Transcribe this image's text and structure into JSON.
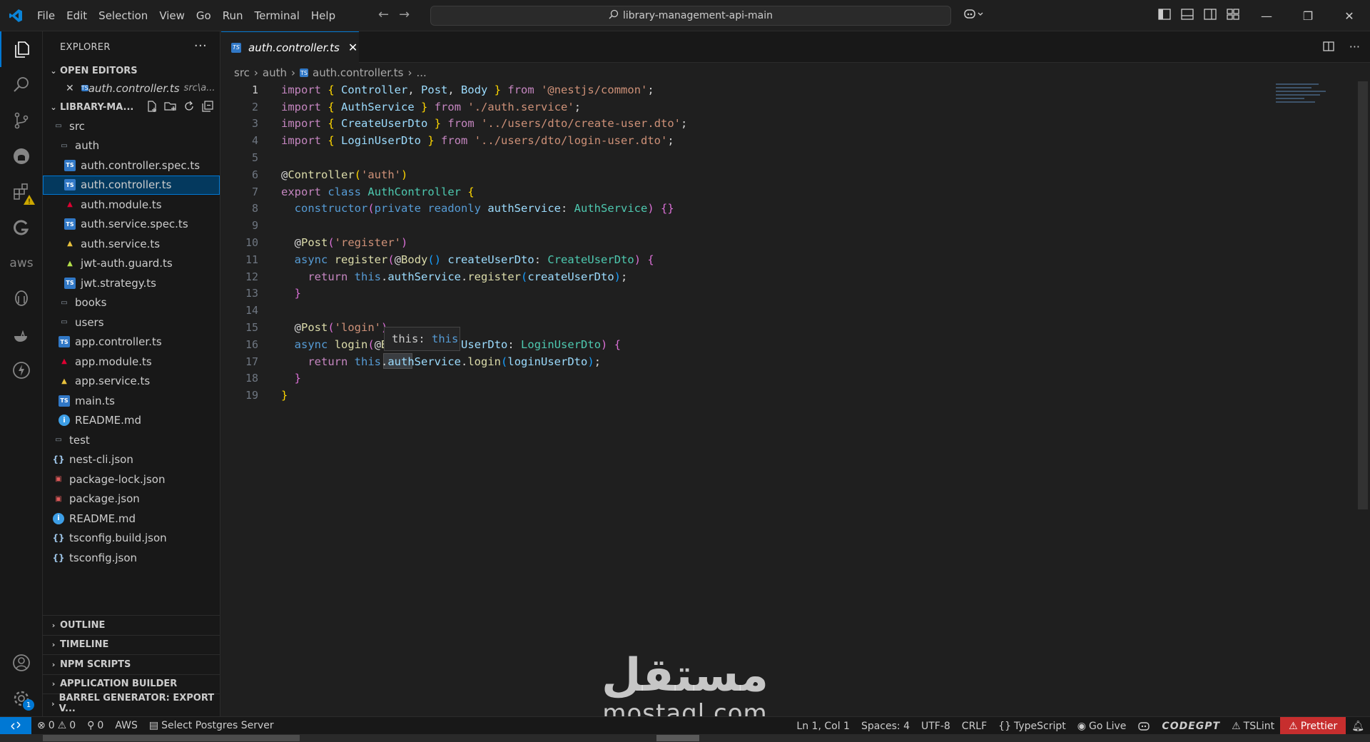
{
  "titlebar": {
    "menu": [
      "File",
      "Edit",
      "Selection",
      "View",
      "Go",
      "Run",
      "Terminal",
      "Help"
    ],
    "search_text": "library-management-api-main"
  },
  "activity_bar": {
    "items": [
      "explorer-icon",
      "search-icon",
      "source-control-icon",
      "github-icon",
      "extensions-icon",
      "gitlens-icon",
      "aws-icon",
      "database-icon",
      "docker-icon",
      "lightning-icon"
    ],
    "aws_label": "aws",
    "settings_badge": "1"
  },
  "sidebar": {
    "title": "EXPLORER",
    "open_editors_label": "OPEN EDITORS",
    "open_editor_file": "auth.controller.ts",
    "open_editor_path": "src\\a...",
    "root_label": "LIBRARY-MA...",
    "tree": [
      {
        "name": "src",
        "indent": 0,
        "icon": "folder",
        "selected": false
      },
      {
        "name": "auth",
        "indent": 1,
        "icon": "folder",
        "selected": false
      },
      {
        "name": "auth.controller.spec.ts",
        "indent": 2,
        "icon": "ts",
        "selected": false
      },
      {
        "name": "auth.controller.ts",
        "indent": 2,
        "icon": "ts",
        "selected": true
      },
      {
        "name": "auth.module.ts",
        "indent": 2,
        "icon": "ng",
        "selected": false
      },
      {
        "name": "auth.service.spec.ts",
        "indent": 2,
        "icon": "ts",
        "selected": false
      },
      {
        "name": "auth.service.ts",
        "indent": 2,
        "icon": "ngy",
        "selected": false
      },
      {
        "name": "jwt-auth.guard.ts",
        "indent": 2,
        "icon": "ngg",
        "selected": false
      },
      {
        "name": "jwt.strategy.ts",
        "indent": 2,
        "icon": "ts",
        "selected": false
      },
      {
        "name": "books",
        "indent": 1,
        "icon": "folder",
        "selected": false
      },
      {
        "name": "users",
        "indent": 1,
        "icon": "folder",
        "selected": false
      },
      {
        "name": "app.controller.ts",
        "indent": 1,
        "icon": "ts",
        "selected": false
      },
      {
        "name": "app.module.ts",
        "indent": 1,
        "icon": "ng",
        "selected": false
      },
      {
        "name": "app.service.ts",
        "indent": 1,
        "icon": "ngy",
        "selected": false
      },
      {
        "name": "main.ts",
        "indent": 1,
        "icon": "ts",
        "selected": false
      },
      {
        "name": "README.md",
        "indent": 1,
        "icon": "info",
        "selected": false
      },
      {
        "name": "test",
        "indent": 0,
        "icon": "folder",
        "selected": false
      },
      {
        "name": "nest-cli.json",
        "indent": 0,
        "icon": "json",
        "selected": false
      },
      {
        "name": "package-lock.json",
        "indent": 0,
        "icon": "pkg",
        "selected": false
      },
      {
        "name": "package.json",
        "indent": 0,
        "icon": "pkg",
        "selected": false
      },
      {
        "name": "README.md",
        "indent": 0,
        "icon": "info",
        "selected": false
      },
      {
        "name": "tsconfig.build.json",
        "indent": 0,
        "icon": "json",
        "selected": false
      },
      {
        "name": "tsconfig.json",
        "indent": 0,
        "icon": "json",
        "selected": false
      }
    ],
    "bottom_sections": [
      "OUTLINE",
      "TIMELINE",
      "NPM SCRIPTS",
      "APPLICATION BUILDER",
      "BARREL GENERATOR: EXPORT V..."
    ]
  },
  "editor": {
    "tab_label": "auth.controller.ts",
    "breadcrumb": [
      "src",
      "auth",
      "auth.controller.ts",
      "..."
    ],
    "hover": {
      "label": "this:",
      "value": "this"
    },
    "lines": [
      [
        [
          "kw2",
          "import"
        ],
        [
          "pun",
          " "
        ],
        [
          "br1",
          "{"
        ],
        [
          "pun",
          " "
        ],
        [
          "var",
          "Controller"
        ],
        [
          "pun",
          ", "
        ],
        [
          "var",
          "Post"
        ],
        [
          "pun",
          ", "
        ],
        [
          "var",
          "Body"
        ],
        [
          "pun",
          " "
        ],
        [
          "br1",
          "}"
        ],
        [
          "pun",
          " "
        ],
        [
          "kw2",
          "from"
        ],
        [
          "pun",
          " "
        ],
        [
          "str",
          "'@nestjs/common'"
        ],
        [
          "pun",
          ";"
        ]
      ],
      [
        [
          "kw2",
          "import"
        ],
        [
          "pun",
          " "
        ],
        [
          "br1",
          "{"
        ],
        [
          "pun",
          " "
        ],
        [
          "var",
          "AuthService"
        ],
        [
          "pun",
          " "
        ],
        [
          "br1",
          "}"
        ],
        [
          "pun",
          " "
        ],
        [
          "kw2",
          "from"
        ],
        [
          "pun",
          " "
        ],
        [
          "str",
          "'./auth.service'"
        ],
        [
          "pun",
          ";"
        ]
      ],
      [
        [
          "kw2",
          "import"
        ],
        [
          "pun",
          " "
        ],
        [
          "br1",
          "{"
        ],
        [
          "pun",
          " "
        ],
        [
          "var",
          "CreateUserDto"
        ],
        [
          "pun",
          " "
        ],
        [
          "br1",
          "}"
        ],
        [
          "pun",
          " "
        ],
        [
          "kw2",
          "from"
        ],
        [
          "pun",
          " "
        ],
        [
          "str",
          "'../users/dto/create-user.dto'"
        ],
        [
          "pun",
          ";"
        ]
      ],
      [
        [
          "kw2",
          "import"
        ],
        [
          "pun",
          " "
        ],
        [
          "br1",
          "{"
        ],
        [
          "pun",
          " "
        ],
        [
          "var",
          "LoginUserDto"
        ],
        [
          "pun",
          " "
        ],
        [
          "br1",
          "}"
        ],
        [
          "pun",
          " "
        ],
        [
          "kw2",
          "from"
        ],
        [
          "pun",
          " "
        ],
        [
          "str",
          "'../users/dto/login-user.dto'"
        ],
        [
          "pun",
          ";"
        ]
      ],
      [],
      [
        [
          "pun",
          "@"
        ],
        [
          "fn",
          "Controller"
        ],
        [
          "br1",
          "("
        ],
        [
          "str",
          "'auth'"
        ],
        [
          "br1",
          ")"
        ]
      ],
      [
        [
          "kw2",
          "export"
        ],
        [
          "pun",
          " "
        ],
        [
          "kw",
          "class"
        ],
        [
          "pun",
          " "
        ],
        [
          "cls",
          "AuthController"
        ],
        [
          "pun",
          " "
        ],
        [
          "br1",
          "{"
        ]
      ],
      [
        [
          "pun",
          "  "
        ],
        [
          "kw",
          "constructor"
        ],
        [
          "br2",
          "("
        ],
        [
          "kw",
          "private"
        ],
        [
          "pun",
          " "
        ],
        [
          "kw",
          "readonly"
        ],
        [
          "pun",
          " "
        ],
        [
          "var",
          "authService"
        ],
        [
          "pun",
          ": "
        ],
        [
          "cls",
          "AuthService"
        ],
        [
          "br2",
          ")"
        ],
        [
          "pun",
          " "
        ],
        [
          "br2",
          "{}"
        ]
      ],
      [],
      [
        [
          "pun",
          "  @"
        ],
        [
          "fn",
          "Post"
        ],
        [
          "br2",
          "("
        ],
        [
          "str",
          "'register'"
        ],
        [
          "br2",
          ")"
        ]
      ],
      [
        [
          "pun",
          "  "
        ],
        [
          "kw",
          "async"
        ],
        [
          "pun",
          " "
        ],
        [
          "fn",
          "register"
        ],
        [
          "br2",
          "("
        ],
        [
          "pun",
          "@"
        ],
        [
          "fn",
          "Body"
        ],
        [
          "br3",
          "()"
        ],
        [
          "pun",
          " "
        ],
        [
          "var",
          "createUserDto"
        ],
        [
          "pun",
          ": "
        ],
        [
          "cls",
          "CreateUserDto"
        ],
        [
          "br2",
          ")"
        ],
        [
          "pun",
          " "
        ],
        [
          "br2",
          "{"
        ]
      ],
      [
        [
          "pun",
          "    "
        ],
        [
          "kw2",
          "return"
        ],
        [
          "pun",
          " "
        ],
        [
          "kw",
          "this"
        ],
        [
          "pun",
          "."
        ],
        [
          "var",
          "authService"
        ],
        [
          "pun",
          "."
        ],
        [
          "fn",
          "register"
        ],
        [
          "br3",
          "("
        ],
        [
          "var",
          "createUserDto"
        ],
        [
          "br3",
          ")"
        ],
        [
          "pun",
          ";"
        ]
      ],
      [
        [
          "pun",
          "  "
        ],
        [
          "br2",
          "}"
        ]
      ],
      [],
      [
        [
          "pun",
          "  @"
        ],
        [
          "fn",
          "Post"
        ],
        [
          "br2",
          "("
        ],
        [
          "str",
          "'login'"
        ],
        [
          "br2",
          ")"
        ]
      ],
      [
        [
          "pun",
          "  "
        ],
        [
          "kw",
          "async"
        ],
        [
          "pun",
          " "
        ],
        [
          "fn",
          "login"
        ],
        [
          "br2",
          "("
        ],
        [
          "pun",
          "@"
        ],
        [
          "fn",
          "Body"
        ],
        [
          "br3",
          "()"
        ],
        [
          "pun",
          " "
        ],
        [
          "var",
          "loginUserDto"
        ],
        [
          "pun",
          ": "
        ],
        [
          "cls",
          "LoginUserDto"
        ],
        [
          "br2",
          ")"
        ],
        [
          "pun",
          " "
        ],
        [
          "br2",
          "{"
        ]
      ],
      [
        [
          "pun",
          "    "
        ],
        [
          "kw2",
          "return"
        ],
        [
          "pun",
          " "
        ],
        [
          "kw",
          "this"
        ],
        [
          "pun",
          "."
        ],
        [
          "var",
          "authService"
        ],
        [
          "pun",
          "."
        ],
        [
          "fn",
          "login"
        ],
        [
          "br3",
          "("
        ],
        [
          "var",
          "loginUserDto"
        ],
        [
          "br3",
          ")"
        ],
        [
          "pun",
          ";"
        ]
      ],
      [
        [
          "pun",
          "  "
        ],
        [
          "br2",
          "}"
        ]
      ],
      [
        [
          "br1",
          "}"
        ]
      ]
    ]
  },
  "statusbar": {
    "errors": "0",
    "warnings": "0",
    "ports": "0",
    "aws": "AWS",
    "postgres": "Select Postgres Server",
    "cursor": "Ln 1, Col 1",
    "spaces": "Spaces: 4",
    "encoding": "UTF-8",
    "eol": "CRLF",
    "language": "TypeScript",
    "golive": "Go Live",
    "codegpt": "CODEGPT",
    "tslint": "TSLint",
    "prettier": "Prettier"
  },
  "watermark": {
    "arabic": "مستقل",
    "latin": "mostaql.com"
  },
  "colors": {
    "accent": "#0078d4",
    "selection": "#04395e",
    "prettier_error": "#c72e2e"
  }
}
